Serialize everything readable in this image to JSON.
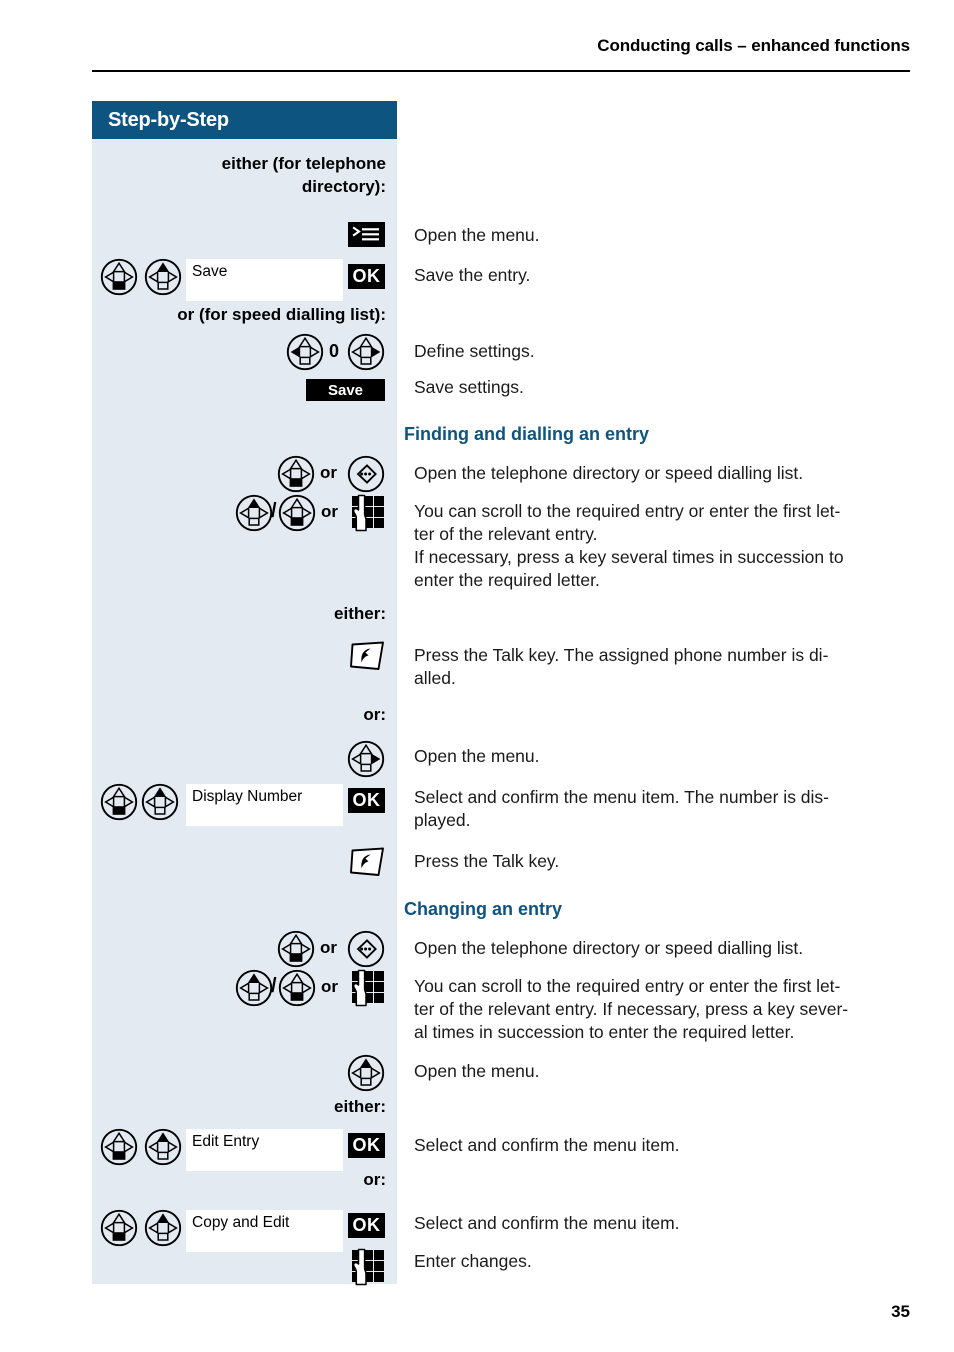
{
  "header": {
    "running_head": "Conducting calls – enhanced functions"
  },
  "sidebar": {
    "title": "Step-by-Step",
    "bg_color": "#0d5580",
    "body_color": "#e3eaf2"
  },
  "page": {
    "number": "35",
    "accent_color": "#0d5580"
  },
  "rows": [
    {
      "id": "either-telephone-directory",
      "label": "either (for telephone directory):"
    },
    {
      "id": "open-menu-1",
      "icon": "menu-key-icon",
      "text": "Open the menu."
    },
    {
      "id": "save-the-entry",
      "icons": [
        "nav-key-down-icon",
        "nav-key-up-icon"
      ],
      "list_value": "Save",
      "confirm_label": "OK",
      "text": "Save the entry."
    },
    {
      "id": "or-speed-dialling-list",
      "label": "or (for speed dialling list):"
    },
    {
      "id": "define-settings",
      "icons": [
        "nav-key-left-icon",
        "nav-key-right-icon"
      ],
      "digit": "0",
      "text": "Define settings."
    },
    {
      "id": "save-settings",
      "softkey_label": "Save",
      "text": "Save settings."
    },
    {
      "id": "finding-and-dialling",
      "heading": "Finding and dialling an entry"
    },
    {
      "id": "open-directory-1",
      "icons": [
        "nav-key-down-icon",
        "directory-key-icon"
      ],
      "or": "or",
      "text": "Open the telephone directory or speed dialling list."
    },
    {
      "id": "scroll-or-enter-1",
      "icons": [
        "nav-key-up-icon",
        "nav-key-down-icon",
        "keypad-icon"
      ],
      "slash": "/",
      "or": "or",
      "text": "You can scroll to the required entry or enter the first letter of the relevant entry.\nIf necessary, press a key several times in succession to enter the required letter."
    },
    {
      "id": "either-1",
      "label": "either:"
    },
    {
      "id": "press-talk-1",
      "icon": "talk-key-icon",
      "text": "Press the Talk key. The assigned phone number is dialled."
    },
    {
      "id": "or-1",
      "label": "or:"
    },
    {
      "id": "open-menu-2",
      "icon": "nav-key-right-icon",
      "text": "Open the menu."
    },
    {
      "id": "display-number",
      "icons": [
        "nav-key-down-icon",
        "nav-key-up-icon"
      ],
      "list_value": "Display Number",
      "confirm_label": "OK",
      "text": "Select and confirm the menu item. The number is displayed."
    },
    {
      "id": "press-talk-2",
      "icon": "talk-key-icon",
      "text": "Press the Talk key."
    },
    {
      "id": "changing-an-entry",
      "heading": "Changing an entry"
    },
    {
      "id": "open-directory-2",
      "icons": [
        "nav-key-down-icon",
        "directory-key-icon"
      ],
      "or": "or",
      "text": "Open the telephone directory or speed dialling list."
    },
    {
      "id": "scroll-or-enter-2",
      "icons": [
        "nav-key-up-icon",
        "nav-key-down-icon",
        "keypad-icon"
      ],
      "slash": "/",
      "or": "or",
      "text": "You can scroll to the required entry or enter the first letter of the relevant entry. If necessary, press a key several times in succession to enter the required letter."
    },
    {
      "id": "open-menu-3",
      "icon": "nav-key-up-icon",
      "text": "Open the menu."
    },
    {
      "id": "either-2",
      "label": "either:"
    },
    {
      "id": "edit-entry",
      "icons": [
        "nav-key-down-icon",
        "nav-key-up-icon"
      ],
      "list_value": "Edit Entry",
      "confirm_label": "OK",
      "text": "Select and confirm the menu item."
    },
    {
      "id": "or-2",
      "label": "or:"
    },
    {
      "id": "copy-and-edit",
      "icons": [
        "nav-key-down-icon",
        "nav-key-up-icon"
      ],
      "list_value": "Copy and Edit",
      "confirm_label": "OK",
      "text": "Select and confirm the menu item."
    },
    {
      "id": "enter-changes",
      "icon": "keypad-icon",
      "text": "Enter changes."
    }
  ],
  "labels": {
    "either_telephone_directory_l1": "either (for telephone",
    "either_telephone_directory_l2": "directory):",
    "or_speed_dialling": "or (for speed dialling list):",
    "either_1": "either:",
    "or_1": "or:",
    "either_2": "either:",
    "or_2": "or:",
    "or_word_a": "or",
    "or_word_b": "or",
    "or_word_c": "or",
    "or_word_d": "or",
    "slash_a": "/",
    "slash_b": "/",
    "digit_zero": "0"
  },
  "text": {
    "open_menu_1": "Open the menu.",
    "save_the_entry": "Save the entry.",
    "define_settings": "Define settings.",
    "save_settings": "Save settings.",
    "heading_finding": "Finding and dialling an entry",
    "open_directory_1": "Open the telephone directory or speed dialling list.",
    "scroll_1_a": "You can scroll to the required entry or enter the first let-",
    "scroll_1_b": "ter of the relevant entry.",
    "scroll_1_c": "If necessary, press a key several times in succession to",
    "scroll_1_d": "enter the required letter.",
    "press_talk_1_a": "Press the Talk key. The assigned phone number is di-",
    "press_talk_1_b": "alled.",
    "open_menu_2": "Open the menu.",
    "display_number_a": "Select and confirm the menu item. The number is dis-",
    "display_number_b": "played.",
    "press_talk_2": "Press the Talk key.",
    "heading_changing": "Changing an entry",
    "open_directory_2": "Open the telephone directory or speed dialling list.",
    "scroll_2_a": "You can scroll to the required entry or enter the first let-",
    "scroll_2_b": "ter of the relevant entry. If necessary, press a key sever-",
    "scroll_2_c": "al times in succession to enter the required letter.",
    "open_menu_3": "Open the menu.",
    "edit_entry": "Select and confirm the menu item.",
    "copy_and_edit": "Select and confirm the menu item.",
    "enter_changes": "Enter changes."
  },
  "values": {
    "list_save": "Save",
    "list_display_number": "Display Number",
    "list_edit_entry": "Edit Entry",
    "list_copy_and_edit": "Copy and Edit",
    "ok_1": "OK",
    "ok_2": "OK",
    "ok_3": "OK",
    "ok_4": "OK",
    "softkey_save": "Save"
  }
}
